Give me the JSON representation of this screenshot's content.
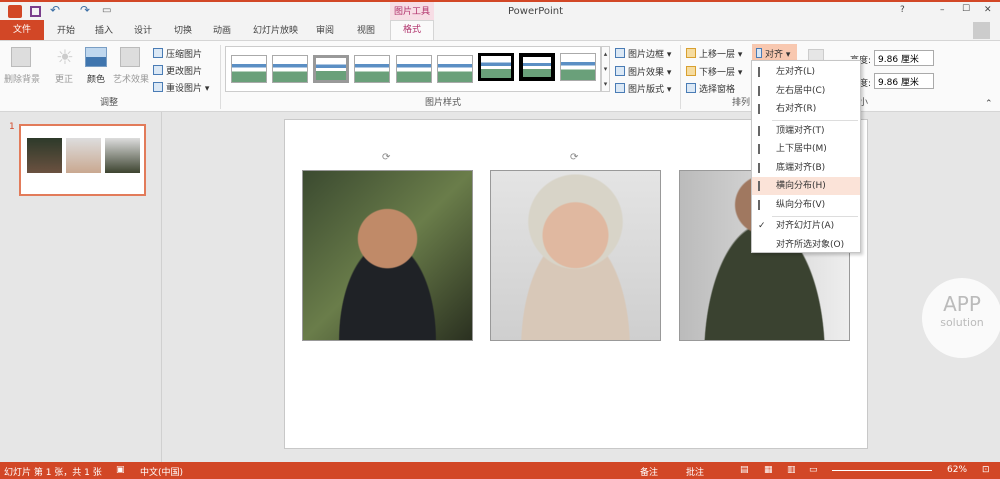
{
  "titlebar": {
    "app_title": "PowerPoint",
    "context_tab": "图片工具",
    "help": "?",
    "minimize": "–",
    "maximize": "☐",
    "close": "✕"
  },
  "tabs": {
    "file": "文件",
    "items": [
      "开始",
      "插入",
      "设计",
      "切换",
      "动画",
      "幻灯片放映",
      "审阅",
      "视图",
      "格式"
    ],
    "active": "格式"
  },
  "ribbon": {
    "adjust": {
      "label": "调整",
      "remove_bg": "删除背景",
      "corrections": "更正",
      "color": "颜色",
      "artistic": "艺术效果",
      "compress": "压缩图片",
      "change": "更改图片",
      "reset": "重设图片"
    },
    "styles": {
      "label": "图片样式",
      "border": "图片边框",
      "effects": "图片效果",
      "layout": "图片版式"
    },
    "arrange": {
      "label": "排列",
      "bring_forward": "上移一层",
      "send_backward": "下移一层",
      "selection_pane": "选择窗格",
      "align": "对齐"
    },
    "size": {
      "label": "大小",
      "height_label": "高度:",
      "height_value": "9.86 厘米",
      "width_label": "宽度:",
      "width_value": "9.86 厘米"
    }
  },
  "align_menu": {
    "items": [
      {
        "label": "左对齐(L)",
        "icon": "align-left-icon"
      },
      {
        "label": "左右居中(C)",
        "icon": "align-center-icon"
      },
      {
        "label": "右对齐(R)",
        "icon": "align-right-icon"
      },
      {
        "label": "顶端对齐(T)",
        "icon": "align-top-icon"
      },
      {
        "label": "上下居中(M)",
        "icon": "align-middle-icon"
      },
      {
        "label": "底端对齐(B)",
        "icon": "align-bottom-icon"
      },
      {
        "label": "横向分布(H)",
        "icon": "distribute-horizontal-icon",
        "highlighted": true
      },
      {
        "label": "纵向分布(V)",
        "icon": "distribute-vertical-icon"
      },
      {
        "label": "对齐幻灯片(A)",
        "icon": "check-icon",
        "checked": true
      },
      {
        "label": "对齐所选对象(O)",
        "icon": ""
      }
    ]
  },
  "thumbnails": {
    "slide_number": "1"
  },
  "watermark": {
    "text1": "APP",
    "text2": "solution"
  },
  "status": {
    "slide_info": "幻灯片 第 1 张，共 1 张",
    "language": "中文(中国)",
    "notes": "备注",
    "comments": "批注",
    "zoom": "62%"
  },
  "colors": {
    "accent": "#d24726"
  }
}
